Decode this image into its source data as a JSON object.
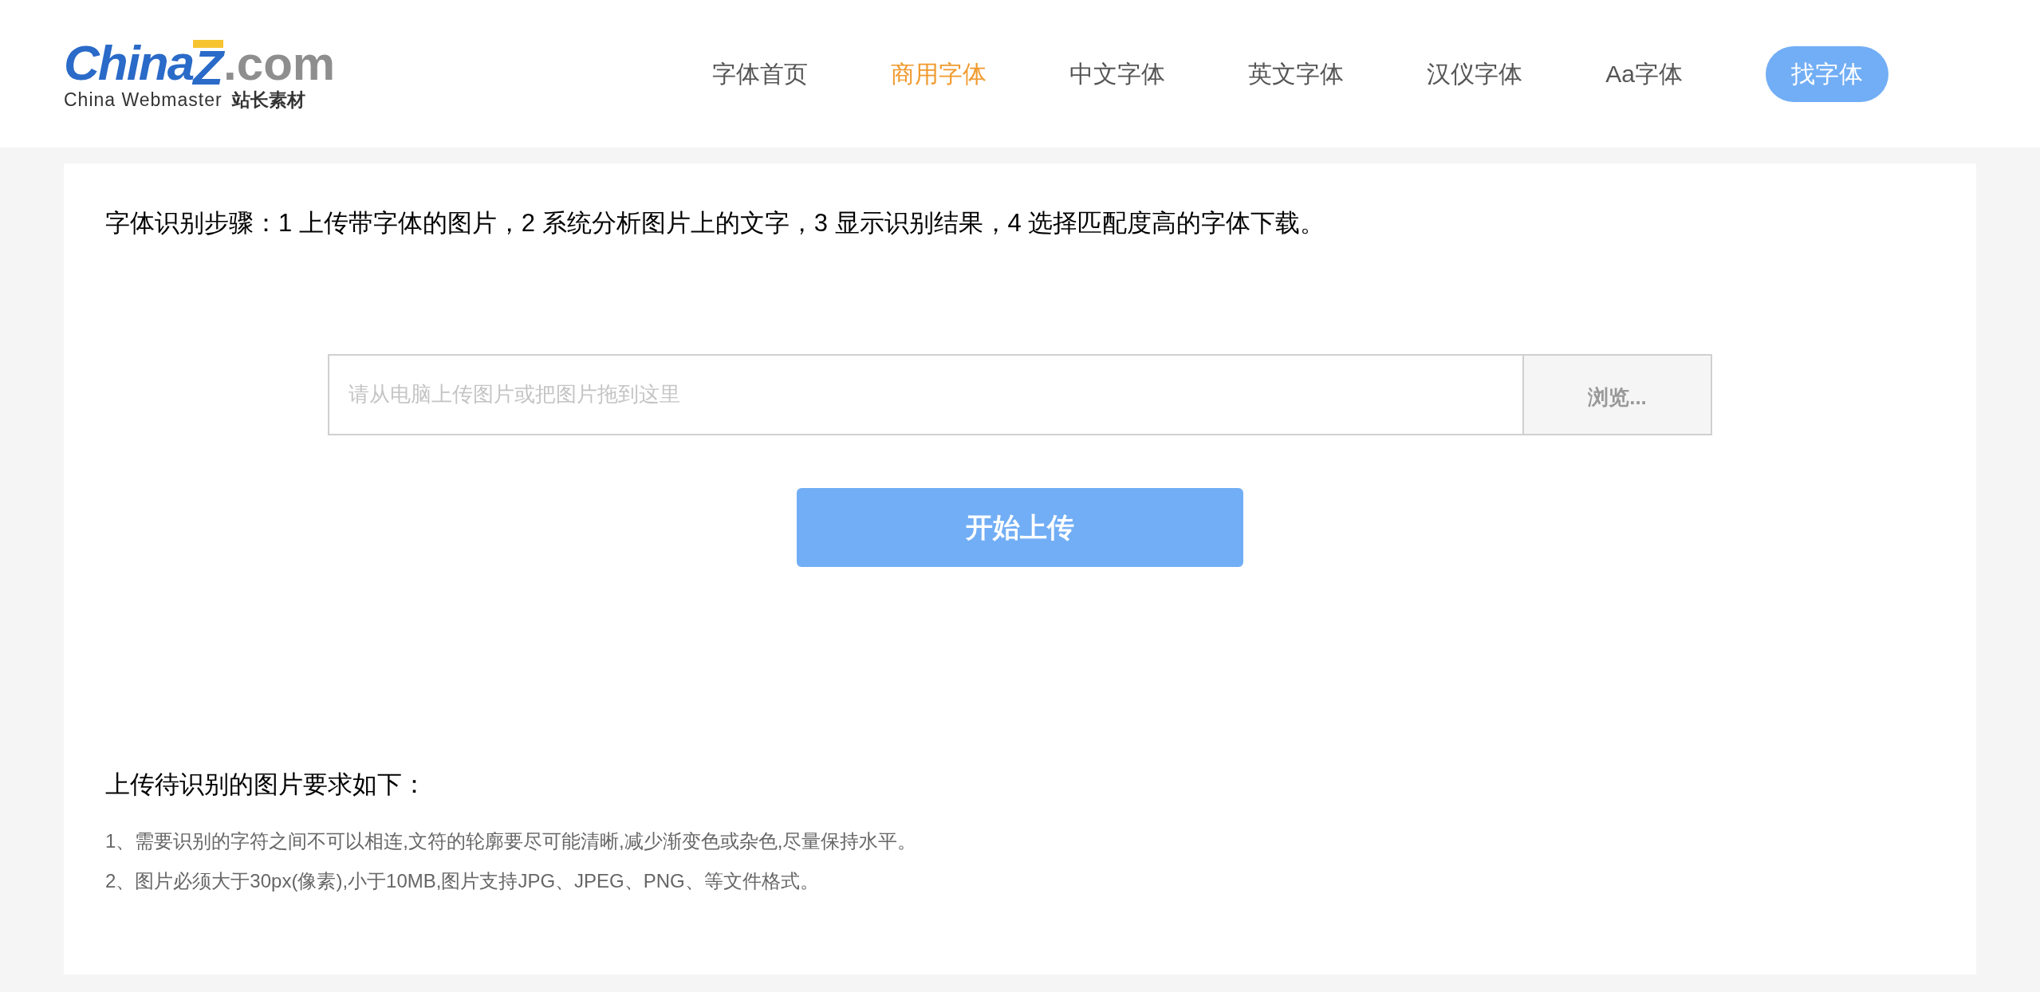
{
  "logo": {
    "brand": "China",
    "mark": "Z",
    "domain": ".com",
    "tagline_en": "China Webmaster",
    "tagline_cn": "站长素材"
  },
  "nav": [
    {
      "label": "字体首页",
      "kind": "link",
      "selected": false
    },
    {
      "label": "商用字体",
      "kind": "link",
      "selected": true
    },
    {
      "label": "中文字体",
      "kind": "link",
      "selected": false
    },
    {
      "label": "英文字体",
      "kind": "link",
      "selected": false
    },
    {
      "label": "汉仪字体",
      "kind": "link",
      "selected": false
    },
    {
      "label": "Aa字体",
      "kind": "link",
      "selected": false
    },
    {
      "label": "找字体",
      "kind": "pill",
      "selected": false
    }
  ],
  "steps": "字体识别步骤：1 上传带字体的图片，2 系统分析图片上的文字，3 显示识别结果，4 选择匹配度高的字体下载。",
  "upload": {
    "placeholder": "请从电脑上传图片或把图片拖到这里",
    "browse": "浏览...",
    "submit": "开始上传"
  },
  "requirements": {
    "title": "上传待识别的图片要求如下：",
    "items": [
      "1、需要识别的字符之间不可以相连,文符的轮廓要尽可能清晰,减少渐变色或杂色,尽量保持水平。",
      "2、图片必须大于30px(像素),小于10MB,图片支持JPG、JPEG、PNG、等文件格式。"
    ]
  }
}
